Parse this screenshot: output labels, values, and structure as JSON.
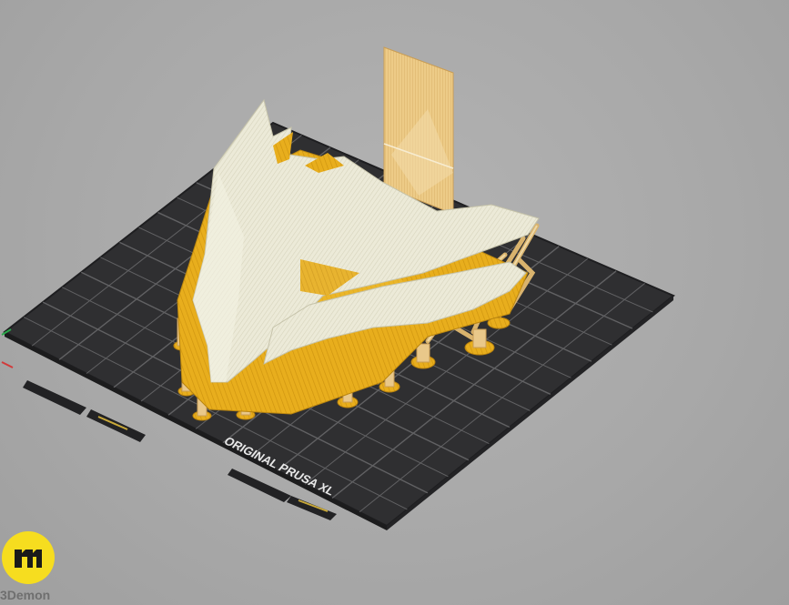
{
  "viewport": {
    "background": "#a9a9a9"
  },
  "bed": {
    "label": "ORIGINAL PRUSA XL",
    "surface_color": "#2f2f31",
    "grid_color": "#6a6a6c"
  },
  "model": {
    "shell_color": "#e7e5d2",
    "interior_color": "#e7ad1c",
    "support_color": "#e9c88a"
  },
  "axes": {
    "x_color": "#d23a3a",
    "y_color": "#2aa84a"
  },
  "watermark": {
    "brand": "3Demon",
    "mark_color": "#f6dd1f"
  }
}
